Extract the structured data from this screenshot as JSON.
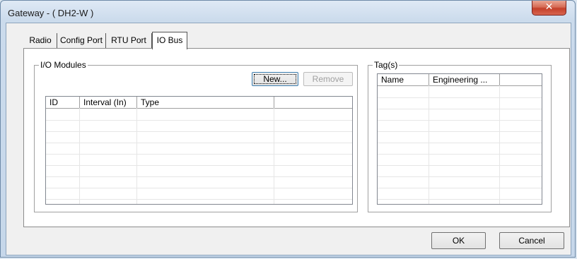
{
  "window": {
    "title": "Gateway - ( DH2-W )"
  },
  "tabs": [
    {
      "label": "Radio",
      "active": false
    },
    {
      "label": "Config Port",
      "active": false
    },
    {
      "label": "RTU Port",
      "active": false
    },
    {
      "label": "IO Bus",
      "active": true
    }
  ],
  "io_modules": {
    "title": "I/O Modules",
    "new_label": "New...",
    "remove_label": "Remove",
    "columns": [
      "ID",
      "Interval (In)",
      "Type",
      ""
    ]
  },
  "tags": {
    "title": "Tag(s)",
    "columns": [
      "Name",
      "Engineering ...",
      ""
    ]
  },
  "footer": {
    "ok_label": "OK",
    "cancel_label": "Cancel"
  },
  "colors": {
    "close_button": "#c94a33",
    "frame": "#c6d7ea"
  }
}
